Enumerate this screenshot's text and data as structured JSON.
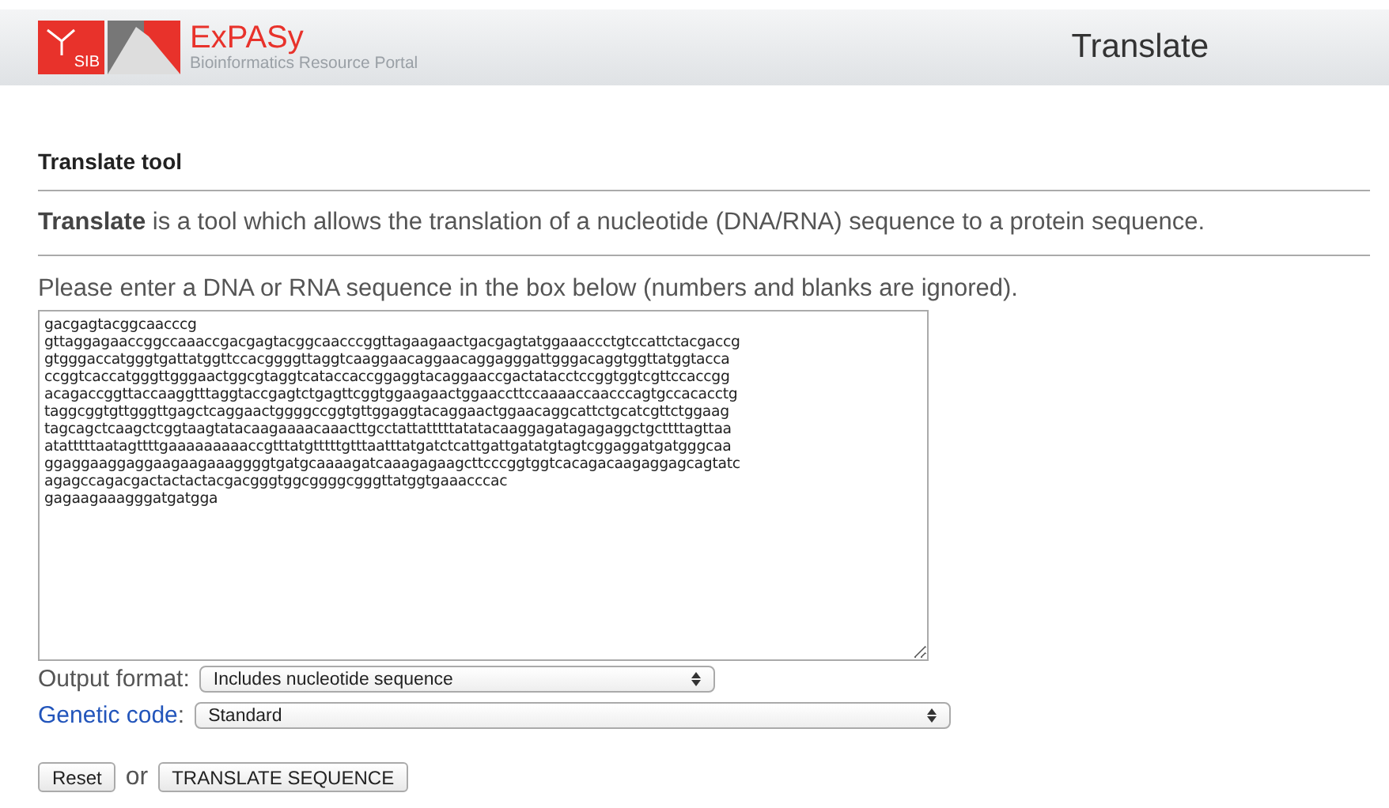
{
  "header": {
    "logo_badge": "SIB",
    "logo_name": "ExPASy",
    "logo_subtitle": "Bioinformatics Resource Portal",
    "title": "Translate"
  },
  "heading": "Translate tool",
  "description": "**Translate** is a tool which allows the translation of a nucleotide (DNA/RNA) sequence to a protein sequence.",
  "prompt": "Please enter a DNA or RNA sequence in the box below (numbers and blanks are ignored).",
  "sequence_lines": [
    "gacgagtacggcaacccg",
    "gttaggagaaccggccaaaccgacgagtacggcaacccggttagaagaactgacgagtatggaaaccctgtccattctacgaccg",
    "gtgggaccatgggtgattatggttccacggggttaggtcaaggaacaggaacaggagggattgggacaggtggttatggtacca",
    "ccggtcaccatgggttgggaactggcgtaggtcataccaccggaggtacaggaaccgactatacctccggtggtcgttccaccgg",
    "acagaccggttaccaaggtttaggtaccgagtctgagttcggtggaagaactggaaccttccaaaaccaacccagtgccacacctg",
    "taggcggtgttgggttgagctcaggaactggggccggtgttggaggtacaggaactggaacaggcattctgcatcgttctggaag",
    "tagcagctcaagctcggtaagtatacaagaaaacaaacttgcctattatttttatatacaaggagatagagaggctgcttttagttaa",
    "atatttttaatagttttgaaaaaaaaaccgtttatgtttttgtttaatttatgatctcattgattgatatgtagtcggaggatgatgggcaa",
    "ggaggaaggaggaagaagaaaggggtgatgcaaaagatcaaagagaagcttcccggtggtcacagacaagaggagcagtatc",
    "agagccagacgactactactacgacgggtggcggggcgggttatggtgaaacccac",
    "gagaagaaagggatgatgga"
  ],
  "options": [
    {
      "label": "Output format",
      "colon": ":",
      "kind": "plain",
      "value": "Includes nucleotide sequence"
    },
    {
      "label": "Genetic code",
      "colon": ":",
      "kind": "link",
      "value": "Standard"
    }
  ],
  "buttons": {
    "reset": "Reset",
    "separator": "or",
    "submit": "TRANSLATE SEQUENCE"
  }
}
